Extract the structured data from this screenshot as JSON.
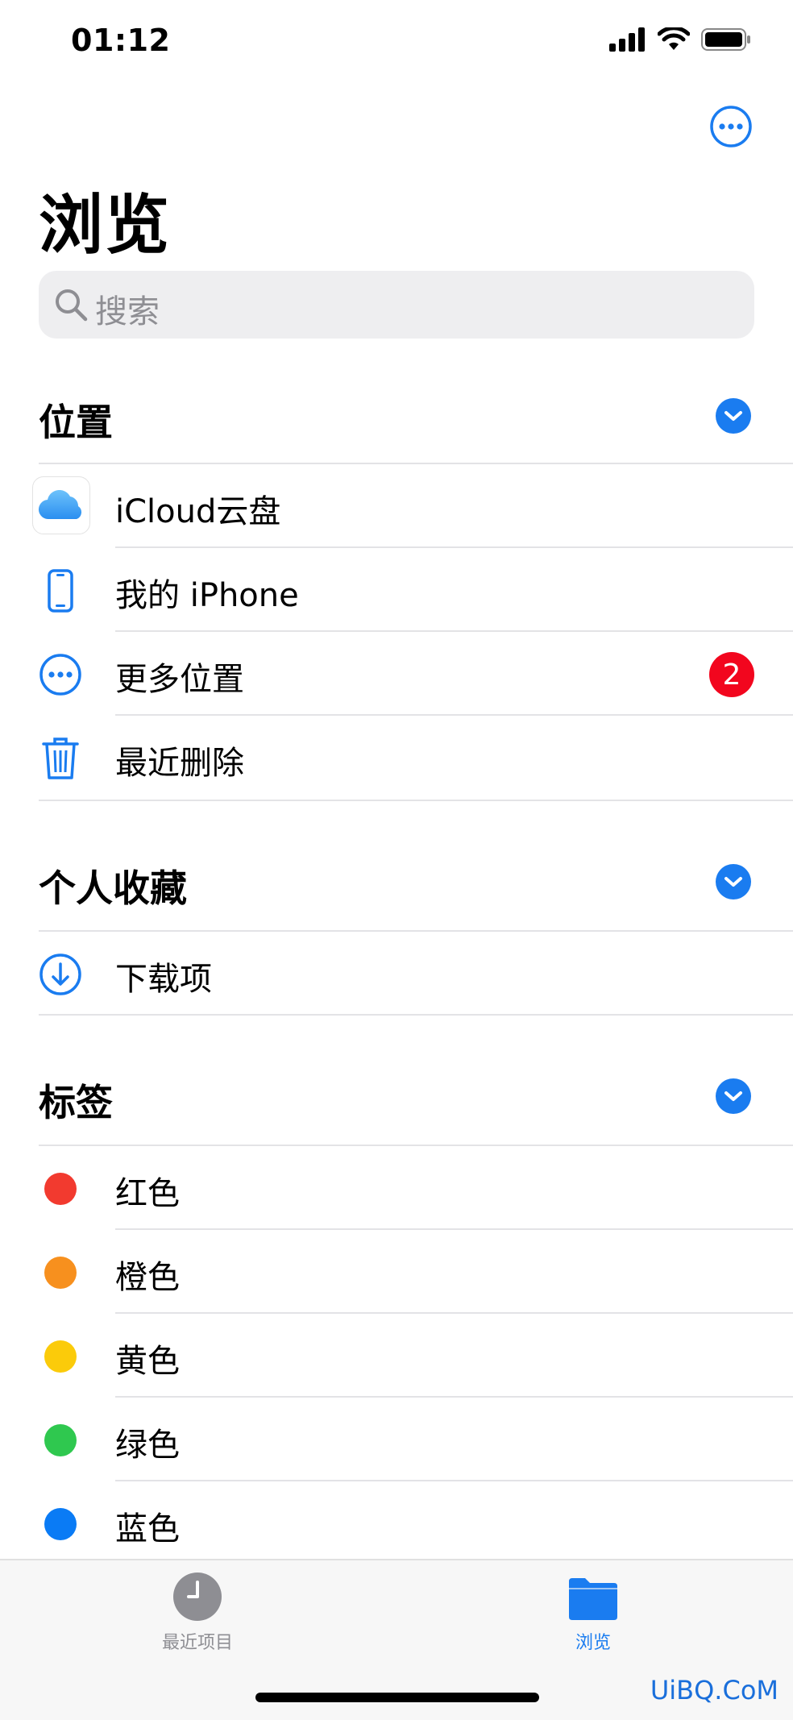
{
  "status_bar": {
    "time": "01:12"
  },
  "page": {
    "title": "浏览"
  },
  "search": {
    "placeholder": "搜索"
  },
  "sections": {
    "locations": {
      "title": "位置",
      "items": [
        {
          "label": "iCloud云盘",
          "icon": "icloud-icon"
        },
        {
          "label": "我的 iPhone",
          "icon": "iphone-icon"
        },
        {
          "label": "更多位置",
          "icon": "ellipsis-circle-icon",
          "badge": "2"
        },
        {
          "label": "最近删除",
          "icon": "trash-icon"
        }
      ]
    },
    "favorites": {
      "title": "个人收藏",
      "items": [
        {
          "label": "下载项",
          "icon": "download-icon"
        }
      ]
    },
    "tags": {
      "title": "标签",
      "items": [
        {
          "label": "红色",
          "color": "#f23a2f"
        },
        {
          "label": "橙色",
          "color": "#f7901e"
        },
        {
          "label": "黄色",
          "color": "#fbcb0a"
        },
        {
          "label": "绿色",
          "color": "#2fc84f"
        },
        {
          "label": "蓝色",
          "color": "#0a7bf5"
        }
      ]
    }
  },
  "tabbar": {
    "tabs": [
      {
        "label": "最近项目",
        "icon": "clock-icon",
        "active": false
      },
      {
        "label": "浏览",
        "icon": "folder-icon",
        "active": true
      }
    ]
  },
  "colors": {
    "accent": "#1a7cf0",
    "badge": "#f2061e",
    "inactive": "#8e8e93"
  },
  "watermark": "UiBQ.CoM"
}
